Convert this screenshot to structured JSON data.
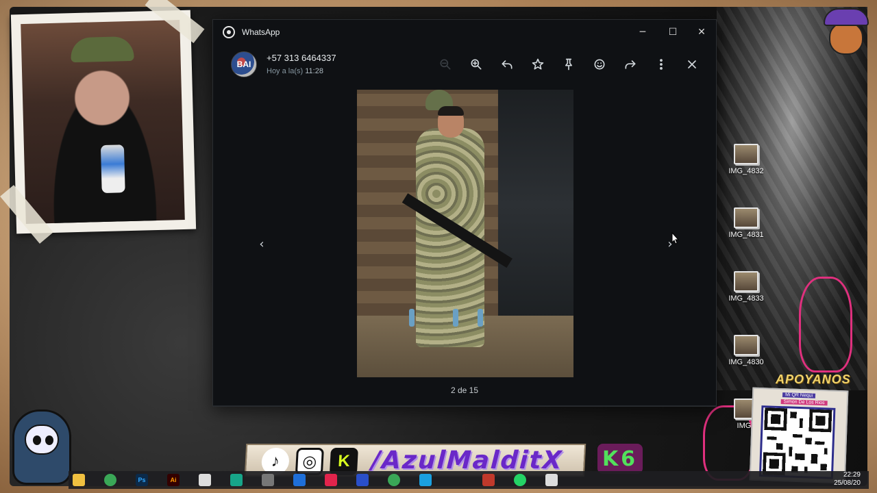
{
  "window": {
    "app_title": "WhatsApp",
    "controls": {
      "minimize": "─",
      "maximize": "☐",
      "close": "✕"
    }
  },
  "viewer": {
    "contact_name": "+57 313 6464337",
    "time_prefix": "Hoy a la(s)",
    "time_value": "11:28",
    "avatar_text": "BAI",
    "counter": "2 de 15",
    "prev_arrow": "‹",
    "next_arrow": "›",
    "toolbar": [
      {
        "name": "zoom-out-icon",
        "disabled": true
      },
      {
        "name": "zoom-in-icon",
        "disabled": false
      },
      {
        "name": "reply-icon",
        "disabled": false
      },
      {
        "name": "star-icon",
        "disabled": false
      },
      {
        "name": "pin-icon",
        "disabled": false
      },
      {
        "name": "emoji-icon",
        "disabled": false
      },
      {
        "name": "forward-icon",
        "disabled": false
      },
      {
        "name": "more-icon",
        "disabled": false
      },
      {
        "name": "close-icon",
        "disabled": false
      }
    ]
  },
  "desktop_icons": [
    {
      "label": "IMG_4832"
    },
    {
      "label": "IMG_4831"
    },
    {
      "label": "IMG_4833"
    },
    {
      "label": "IMG_4830"
    },
    {
      "label": "IMG_"
    }
  ],
  "overlay": {
    "handle": "/AzulMalditX",
    "k6": "K6",
    "apoyanos": "APOYANOS",
    "qr_line1": "Mi QR Nequi",
    "qr_line2": "Simon De Los Rios"
  },
  "taskbar": {
    "icons": [
      "file-explorer-icon",
      "chrome-icon",
      "photoshop-icon",
      "illustrator-icon",
      "app-icon",
      "app-icon",
      "app-icon",
      "app-icon",
      "tiktok-icon",
      "app-icon",
      "chrome-icon",
      "app-icon",
      "app-icon",
      "whatsapp-icon",
      "app-icon"
    ],
    "ps_label": "Ps",
    "ai_label": "Ai",
    "clock_time": "22:29",
    "clock_date": "25/08/20"
  },
  "colors": {
    "wa_background": "#0f1114",
    "wa_text": "#e9edef",
    "wa_secondary": "#8696a0",
    "brand_purple": "#6a28c8",
    "k6_green": "#52e05c"
  }
}
